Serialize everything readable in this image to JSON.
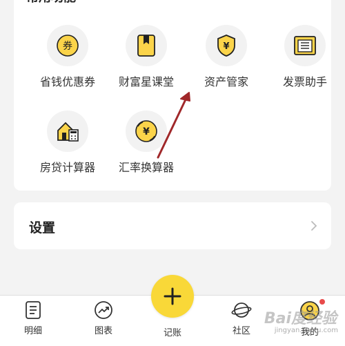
{
  "functions": {
    "title": "常用功能",
    "items": [
      {
        "label": "省钱优惠券",
        "icon": "coupon-icon"
      },
      {
        "label": "财富星课堂",
        "icon": "book-icon"
      },
      {
        "label": "资产管家",
        "icon": "shield-yuan-icon"
      },
      {
        "label": "发票助手",
        "icon": "invoice-icon"
      },
      {
        "label": "房贷计算器",
        "icon": "house-calculator-icon"
      },
      {
        "label": "汇率换算器",
        "icon": "currency-exchange-icon"
      }
    ]
  },
  "settings": {
    "label": "设置"
  },
  "tabbar": {
    "tabs": [
      {
        "label": "明细",
        "icon": "list-icon"
      },
      {
        "label": "图表",
        "icon": "trend-chart-icon"
      },
      {
        "label": "记账",
        "icon": "plus-icon"
      },
      {
        "label": "社区",
        "icon": "planet-icon"
      },
      {
        "label": "我的",
        "icon": "profile-icon"
      }
    ]
  },
  "watermark": {
    "text": "Bai度经验",
    "sub": "jingyan.baidu.com"
  },
  "colors": {
    "accent": "#f9d838",
    "icon_fill": "#fbd44a",
    "badge": "#e84b4b",
    "arrow": "#a0282a"
  }
}
